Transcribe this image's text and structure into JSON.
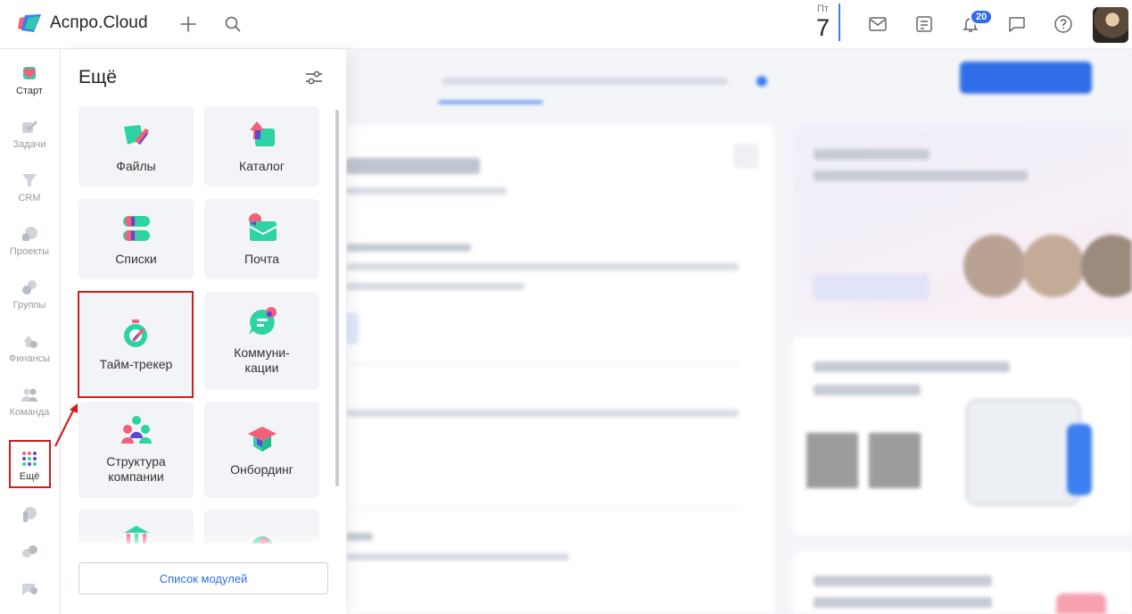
{
  "app": {
    "name": "Аспро.Cloud"
  },
  "header": {
    "date_weekday": "Пт",
    "date_day": "7",
    "notifications_count": "20"
  },
  "rail": {
    "items": [
      {
        "label": "Старт",
        "icon": "heart-icon"
      },
      {
        "label": "Задачи",
        "icon": "tasks-icon"
      },
      {
        "label": "CRM",
        "icon": "crm-funnel-icon"
      },
      {
        "label": "Проекты",
        "icon": "projects-icon"
      },
      {
        "label": "Группы",
        "icon": "groups-icon"
      },
      {
        "label": "Финансы",
        "icon": "finance-icon"
      },
      {
        "label": "Команда",
        "icon": "team-icon"
      },
      {
        "label": "Ещё",
        "icon": "grid-dots-icon"
      }
    ]
  },
  "panel": {
    "title": "Ещё",
    "tiles": [
      {
        "label": "Файлы",
        "icon": "files-icon"
      },
      {
        "label": "Каталог",
        "icon": "catalog-icon"
      },
      {
        "label": "Списки",
        "icon": "lists-icon"
      },
      {
        "label": "Почта",
        "icon": "mail-icon"
      },
      {
        "label": "Тайм-трекер",
        "icon": "timer-icon"
      },
      {
        "label": "Коммуни-кации",
        "icon": "chat-icon"
      },
      {
        "label": "Структура компании",
        "icon": "structure-icon"
      },
      {
        "label": "Онбординг",
        "icon": "onboarding-icon"
      }
    ],
    "modules_button": "Список модулей"
  },
  "colors": {
    "accent": "#2f6ee8",
    "brand_green": "#2ed3a3",
    "brand_pink": "#f2607a",
    "brand_purple": "#5b49d6",
    "highlight": "#d21c1c"
  }
}
